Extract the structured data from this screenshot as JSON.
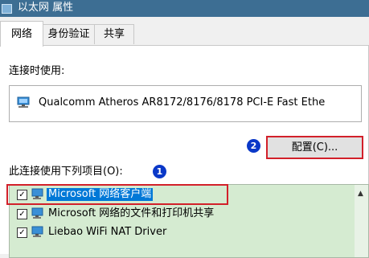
{
  "window": {
    "title": "以太网 属性"
  },
  "tabs": [
    {
      "label": "网络",
      "active": true
    },
    {
      "label": "身份验证"
    },
    {
      "label": "共享"
    }
  ],
  "connect_label": "连接时使用:",
  "adapter": {
    "name": "Qualcomm Atheros AR8172/8176/8178 PCI-E Fast Ethe"
  },
  "configure_button": "配置(C)...",
  "items_label": "此连接使用下列项目(O):",
  "badges": {
    "one": "1",
    "two": "2"
  },
  "items": [
    {
      "label": "Microsoft 网络客户端",
      "checked": true,
      "selected": true
    },
    {
      "label": "Microsoft 网络的文件和打印机共享",
      "checked": true
    },
    {
      "label": "Liebao WiFi NAT Driver",
      "checked": true
    }
  ],
  "colors": {
    "highlight_red": "#d2202a",
    "badge_blue": "#0a38c8",
    "list_green": "#d5ebd1",
    "selection_blue": "#0078d7"
  }
}
